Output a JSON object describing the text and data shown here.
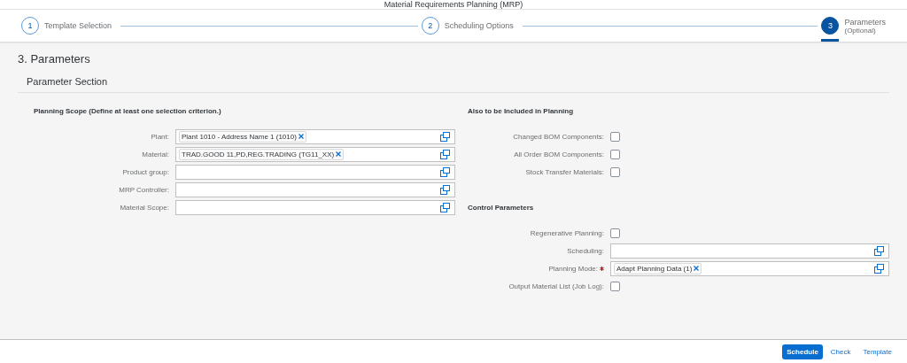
{
  "window": {
    "title": "Material Requirements Planning (MRP)"
  },
  "wizard": {
    "steps": [
      {
        "number": "1",
        "label": "Template Selection",
        "selected": false
      },
      {
        "number": "2",
        "label": "Scheduling Options",
        "selected": false
      },
      {
        "number": "3",
        "label": "Parameters",
        "sublabel": "(Optional)",
        "selected": true
      }
    ]
  },
  "page_title": "3. Parameters",
  "section_title": "Parameter Section",
  "columns": [
    {
      "groups": [
        {
          "title": "Planning Scope (Define at least one selection criterion.)",
          "fields": [
            {
              "kind": "value_help",
              "label": "Plant:",
              "required": false,
              "tokens": [
                "Plant 1010 - Address Name 1 (1010)"
              ]
            },
            {
              "kind": "value_help",
              "label": "Material:",
              "required": false,
              "tokens": [
                "TRAD.GOOD 11,PD,REG.TRADING (TG11_XX)"
              ]
            },
            {
              "kind": "value_help",
              "label": "Product group:",
              "required": false
            },
            {
              "kind": "value_help",
              "label": "MRP Controller:",
              "required": false
            },
            {
              "kind": "value_help",
              "label": "Material Scope:",
              "required": false
            }
          ]
        }
      ]
    },
    {
      "groups": [
        {
          "title": "Also to be Included in Planning",
          "fields": [
            {
              "kind": "checkbox",
              "label": "Changed BOM Components:",
              "checked": false
            },
            {
              "kind": "checkbox",
              "label": "All Order BOM Components:",
              "checked": false
            },
            {
              "kind": "checkbox",
              "label": "Stock Transfer Materials:",
              "checked": false
            }
          ]
        },
        {
          "title": "Control Parameters",
          "fields": [
            {
              "kind": "checkbox",
              "label": "Regenerative Planning:",
              "checked": false
            },
            {
              "kind": "value_help",
              "label": "Scheduling:",
              "required": false
            },
            {
              "kind": "value_help",
              "label": "Planning Mode:",
              "required": true,
              "tokens": [
                "Adapt Planning Data (1)"
              ]
            },
            {
              "kind": "checkbox",
              "label": "Output Material List (Job Log):",
              "checked": false
            }
          ]
        }
      ]
    }
  ],
  "footer": {
    "buttons": [
      {
        "label": "Schedule",
        "kind": "emphasized"
      },
      {
        "label": "Check",
        "kind": "transparent"
      },
      {
        "label": "Template",
        "kind": "transparent"
      }
    ]
  }
}
